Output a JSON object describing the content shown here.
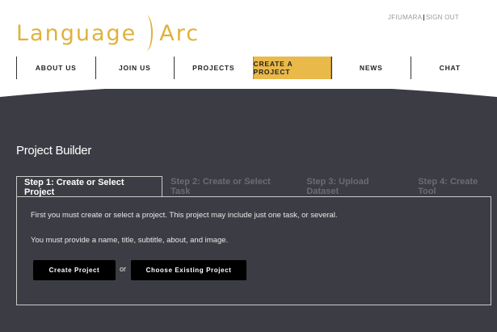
{
  "logo": {
    "left": "Language",
    "right": "Arc"
  },
  "user_links": {
    "user": "JFIUMARA",
    "sign_out": "SIGN OUT"
  },
  "nav": {
    "items": [
      {
        "label": "ABOUT US"
      },
      {
        "label": "JOIN US"
      },
      {
        "label": "PROJECTS"
      },
      {
        "label": "CREATE A PROJECT"
      },
      {
        "label": "NEWS"
      },
      {
        "label": "CHAT"
      }
    ]
  },
  "page": {
    "title": "Project Builder"
  },
  "tabs": [
    {
      "label": "Step 1: Create or Select Project"
    },
    {
      "label": "Step 2: Create or Select Task"
    },
    {
      "label": "Step 3: Upload Dataset"
    },
    {
      "label": "Step 4: Create Tool"
    }
  ],
  "panel": {
    "line1": "First you must create or select a project. This project may include just one task, or several.",
    "line2": "You must provide a name, title, subtitle, about, and image.",
    "create_label": "Create Project",
    "or_label": "or",
    "choose_label": "Choose Existing Project"
  },
  "colors": {
    "accent": "#e9b949",
    "dark_bg": "#3c3d44",
    "text_muted": "#6a6c73"
  }
}
